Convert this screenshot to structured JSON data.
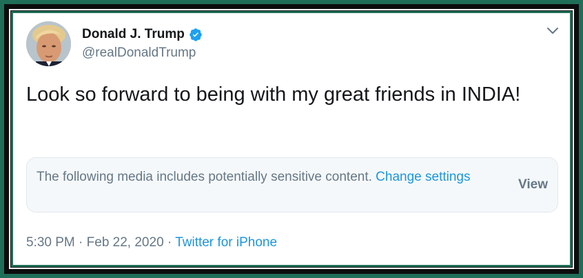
{
  "author": {
    "display_name": "Donald J. Trump",
    "handle": "@realDonaldTrump",
    "verified_icon": "verified-badge-icon",
    "avatar_icon": "profile-photo"
  },
  "tweet": {
    "text": "Look so forward to being with my great friends in INDIA!"
  },
  "sensitive_notice": {
    "message": "The following media includes potentially sensitive content.",
    "change_settings_label": "Change settings",
    "view_label": "View"
  },
  "meta": {
    "time": "5:30 PM",
    "separator": "·",
    "date": "Feb 22, 2020",
    "source": "Twitter for iPhone"
  },
  "colors": {
    "frame": "#1f6e58",
    "link": "#1b95e0",
    "muted": "#657786",
    "text": "#14171a",
    "notice_bg": "#f5f8fa"
  }
}
